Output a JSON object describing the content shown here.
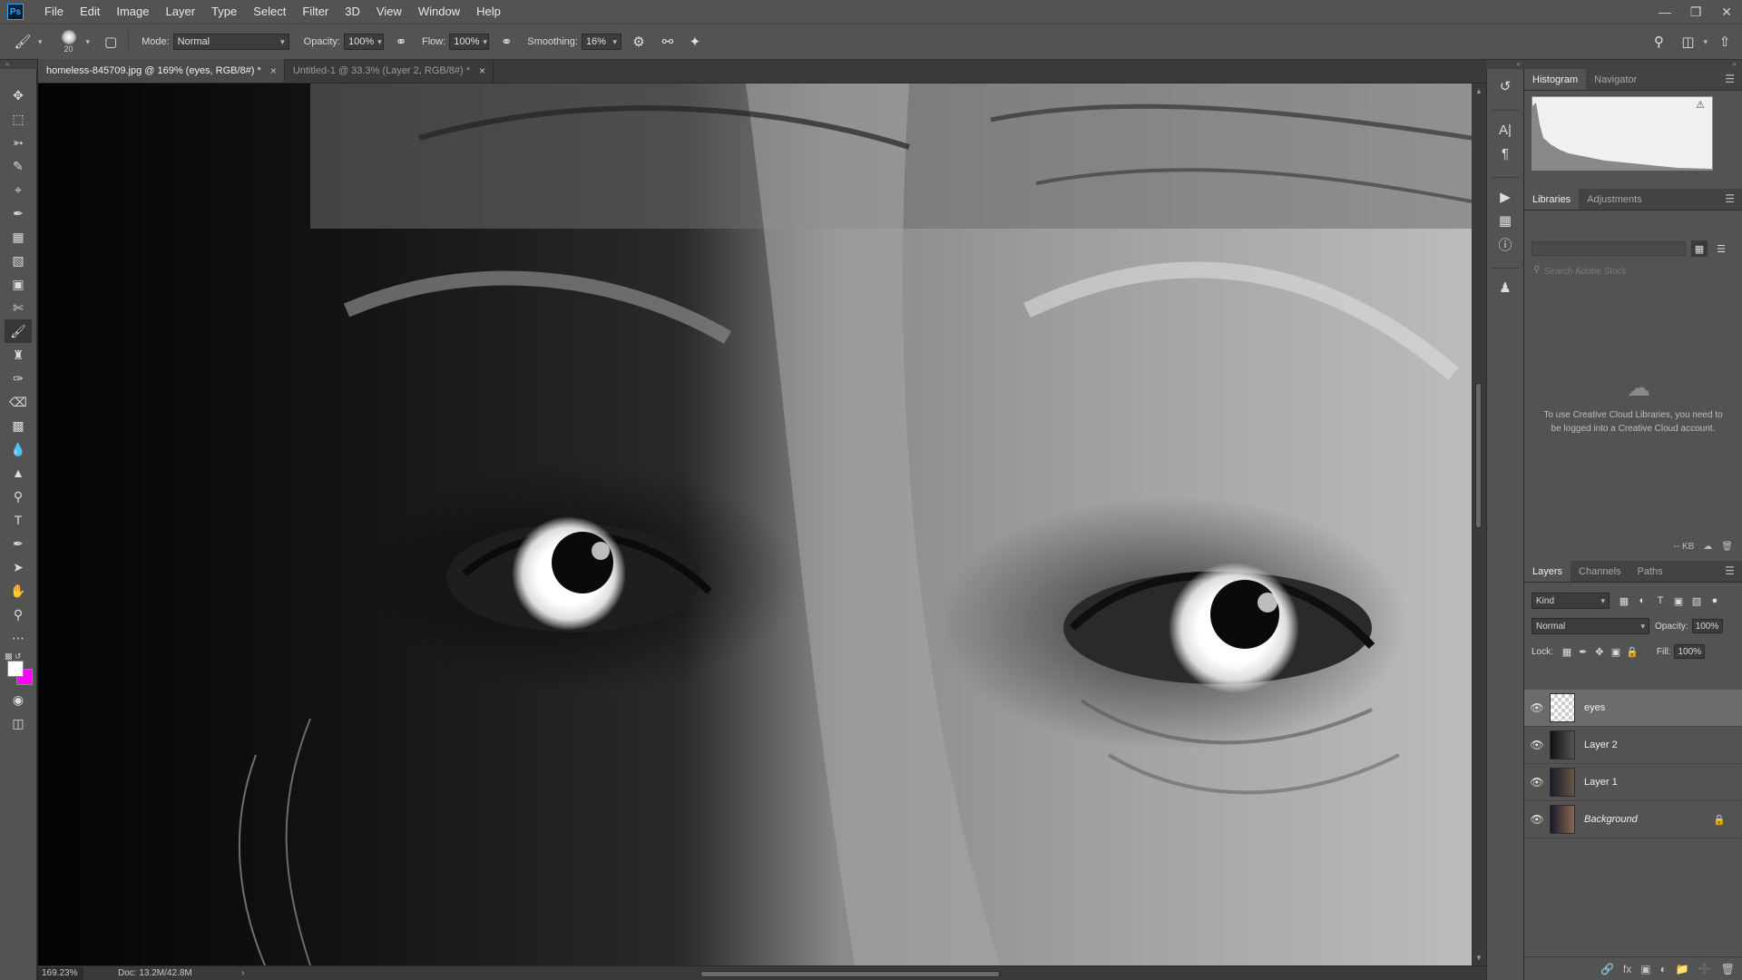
{
  "app": {
    "logo": "Ps"
  },
  "menu": [
    "File",
    "Edit",
    "Image",
    "Layer",
    "Type",
    "Select",
    "Filter",
    "3D",
    "View",
    "Window",
    "Help"
  ],
  "window_controls": [
    "minimize-icon",
    "restore-icon",
    "close-icon"
  ],
  "options": {
    "brush_size": "20",
    "mode_label": "Mode:",
    "mode_value": "Normal",
    "opacity_label": "Opacity:",
    "opacity_value": "100%",
    "flow_label": "Flow:",
    "flow_value": "100%",
    "smoothing_label": "Smoothing:",
    "smoothing_value": "16%"
  },
  "tabs": [
    {
      "label": "homeless-845709.jpg @ 169% (eyes, RGB/8#) *",
      "active": true
    },
    {
      "label": "Untitled-1 @ 33.3% (Layer 2, RGB/8#) *",
      "active": false
    }
  ],
  "colors": {
    "foreground": "#ffffff",
    "background": "#ff00ff",
    "ui_bg": "#535353"
  },
  "status": {
    "zoom": "169.23%",
    "doc": "Doc: 13.2M/42.8M"
  },
  "panels": {
    "top_tabs": [
      "Histogram",
      "Navigator"
    ],
    "lib_tabs": [
      "Libraries",
      "Adjustments"
    ],
    "lib_search_placeholder": "Search Adobe Stock",
    "lib_message": "To use Creative Cloud Libraries, you need to be logged into a Creative Cloud account.",
    "lib_size": "-- KB",
    "layer_tabs": [
      "Layers",
      "Channels",
      "Paths"
    ]
  },
  "layers_controls": {
    "kind": "Kind",
    "blend": "Normal",
    "opacity_label": "Opacity:",
    "opacity_value": "100%",
    "lock_label": "Lock:",
    "fill_label": "Fill:",
    "fill_value": "100%"
  },
  "layers": [
    {
      "name": "eyes",
      "selected": true,
      "italic": false,
      "locked": false
    },
    {
      "name": "Layer 2",
      "selected": false,
      "italic": false,
      "locked": false
    },
    {
      "name": "Layer 1",
      "selected": false,
      "italic": false,
      "locked": false
    },
    {
      "name": "Background",
      "selected": false,
      "italic": true,
      "locked": true
    }
  ]
}
